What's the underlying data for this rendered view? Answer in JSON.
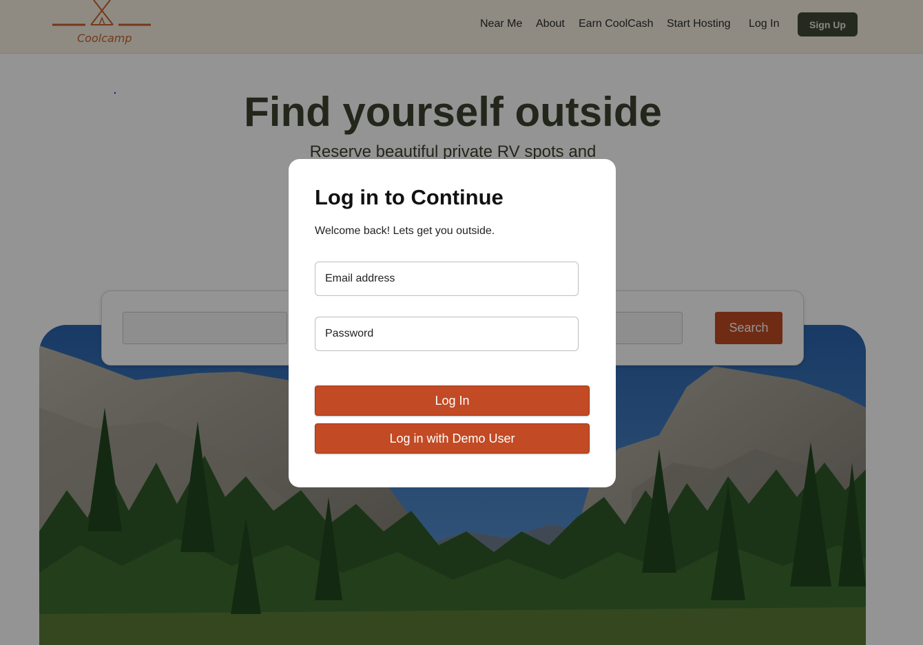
{
  "header": {
    "logo_text": "Coolcamp",
    "nav": [
      "Near Me",
      "About",
      "Earn CoolCash",
      "Start Hosting",
      "Log In"
    ],
    "signup_label": "Sign Up"
  },
  "hero": {
    "title": "Find yourself outside",
    "subtitle": "Reserve beautiful private RV spots and"
  },
  "search": {
    "button_label": "Search"
  },
  "modal": {
    "title": "Log in to Continue",
    "subtitle": "Welcome back! Lets get you outside.",
    "email_placeholder": "Email address",
    "password_placeholder": "Password",
    "login_label": "Log In",
    "demo_label": "Log in with Demo User"
  },
  "colors": {
    "accent": "#c24a24",
    "header_bg": "#f6efe0",
    "signup_bg": "#3e4a34",
    "title_color": "#3d4230"
  }
}
